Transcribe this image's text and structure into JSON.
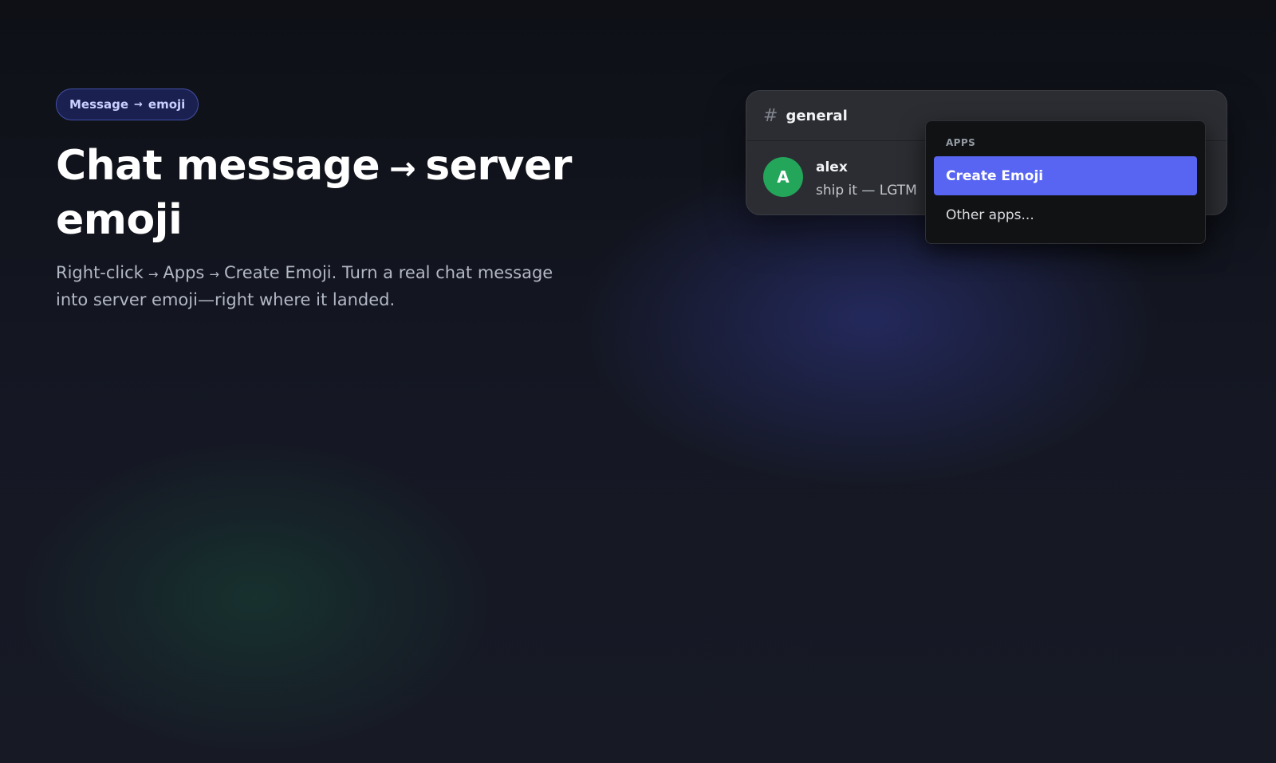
{
  "hero": {
    "badge": {
      "part1": "Message",
      "arrow": "→",
      "part2": "emoji"
    },
    "title": {
      "part1": "Chat message",
      "arrow": "→",
      "part2": "server emoji"
    },
    "lead": {
      "part1": "Right-click",
      "arrow1": "→",
      "part2": "Apps",
      "arrow2": "→",
      "part3": "Create Emoji. Turn a real chat message into server emoji—right where it landed."
    }
  },
  "chat": {
    "channel_symbol": "#",
    "channel_name": "general",
    "message": {
      "avatar_initial": "A",
      "author": "alex",
      "text": "ship it — LGTM"
    }
  },
  "context_menu": {
    "heading": "APPS",
    "items": [
      {
        "label": "Create Emoji",
        "active": true
      },
      {
        "label": "Other apps..."
      }
    ]
  },
  "colors": {
    "accent": "#5865f2",
    "avatar": "#23a55a",
    "badge_border": "#4250a8"
  }
}
